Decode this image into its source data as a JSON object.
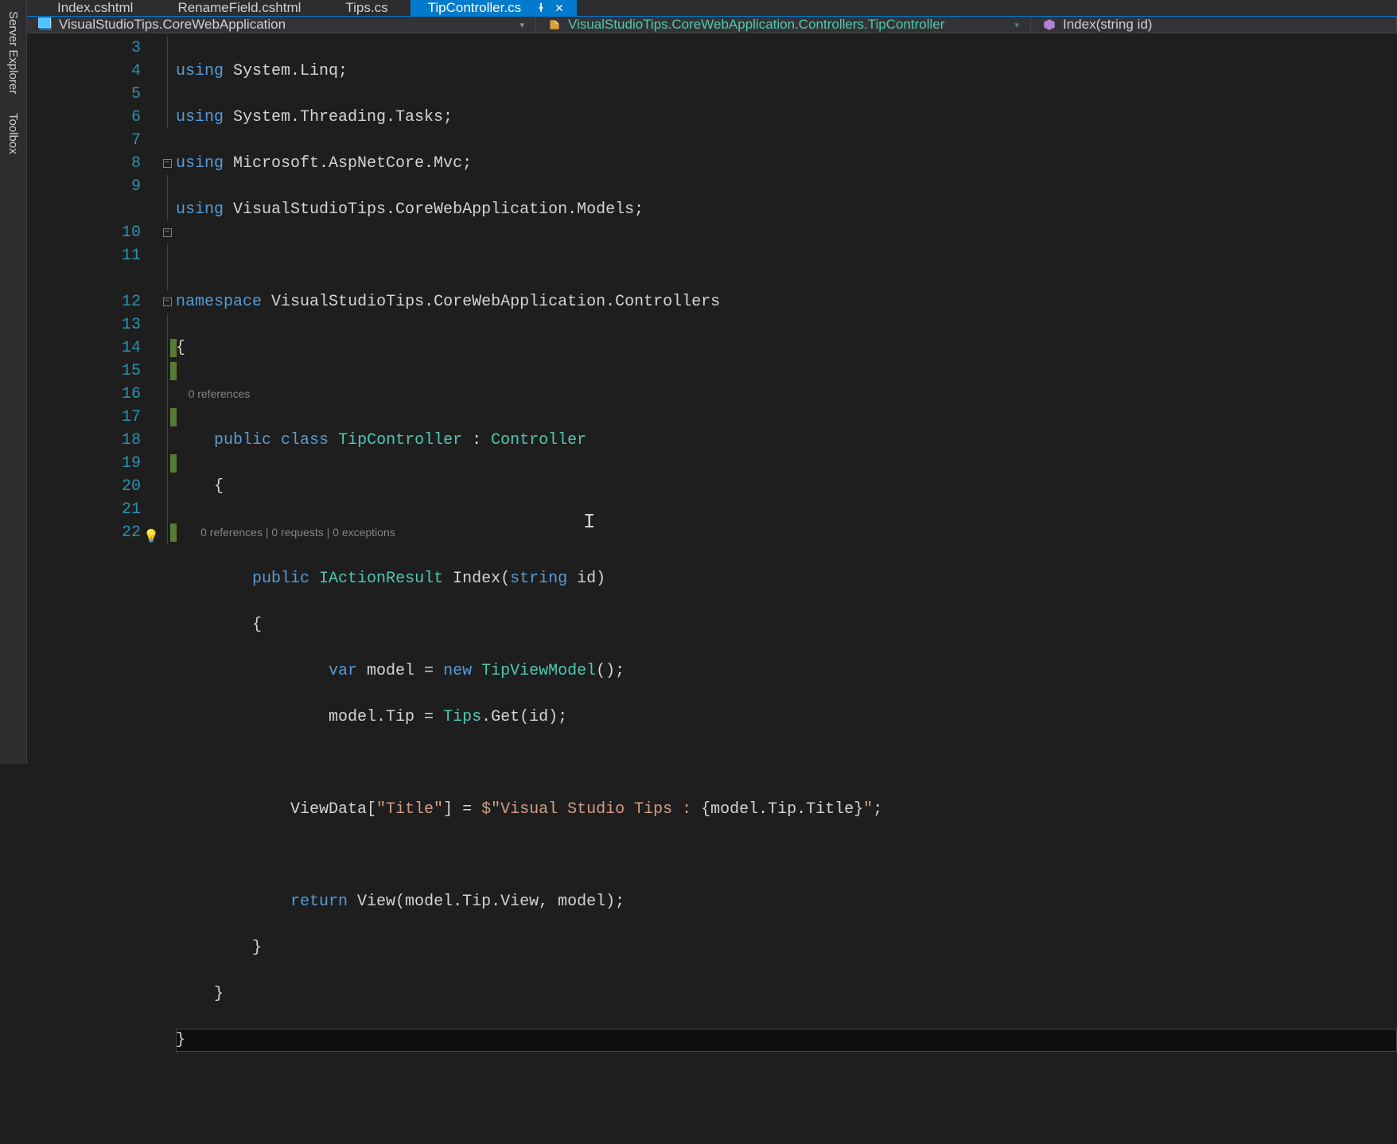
{
  "side_rail": {
    "tabs": [
      "Server Explorer",
      "Toolbox"
    ]
  },
  "document_tabs": [
    {
      "label": "Index.cshtml",
      "active": false
    },
    {
      "label": "RenameField.cshtml",
      "active": false
    },
    {
      "label": "Tips.cs",
      "active": false
    },
    {
      "label": "TipController.cs",
      "active": true
    }
  ],
  "tab_close_glyph": "✕",
  "tab_pin_glyph": "⁃⊡",
  "nav": {
    "project": "VisualStudioTips.CoreWebApplication",
    "type": "VisualStudioTips.CoreWebApplication.Controllers.TipController",
    "member": "Index(string id)"
  },
  "codelens": {
    "class": "0 references",
    "method": "0 references | 0 requests | 0 exceptions"
  },
  "code": {
    "l3": "using System.Linq;",
    "l4": "using System.Threading.Tasks;",
    "l5": "using Microsoft.AspNetCore.Mvc;",
    "l6": "using VisualStudioTips.CoreWebApplication.Models;",
    "l7": "",
    "l8": "namespace VisualStudioTips.CoreWebApplication.Controllers",
    "l9": "{",
    "l10": "    public class TipController : Controller",
    "l11": "    {",
    "l12": "        public IActionResult Index(string id)",
    "l13": "        {",
    "l14": "                var model = new TipViewModel();",
    "l15": "                model.Tip = Tips.Get(id);",
    "l16": "",
    "l17": "            ViewData[\"Title\"] = $\"Visual Studio Tips : {model.Tip.Title}\";",
    "l18": "",
    "l19": "            return View(model.Tip.View, model);",
    "l20": "        }",
    "l21": "    }",
    "l22": "}"
  },
  "line_numbers": [
    3,
    4,
    5,
    6,
    7,
    8,
    9,
    10,
    11,
    12,
    13,
    14,
    15,
    16,
    17,
    18,
    19,
    20,
    21,
    22
  ],
  "changed_lines": [
    14,
    15,
    17,
    19,
    22
  ],
  "quick_action_line": 22
}
